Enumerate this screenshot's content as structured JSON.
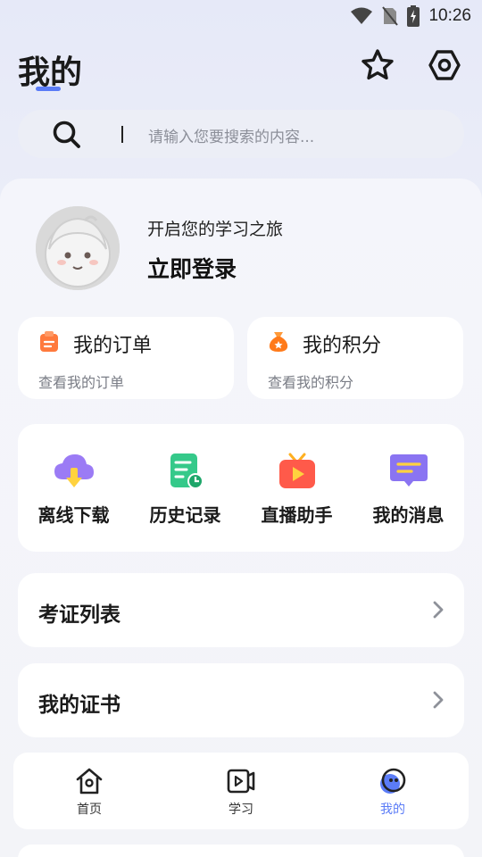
{
  "status": {
    "time": "10:26"
  },
  "header": {
    "title": "我的"
  },
  "search": {
    "placeholder": "请输入您要搜索的内容..."
  },
  "profile": {
    "subtitle": "开启您的学习之旅",
    "login_label": "立即登录"
  },
  "quick_cards": [
    {
      "title": "我的订单",
      "subtitle": "查看我的订单",
      "icon": "clipboard-icon",
      "color": "#ff7a3d"
    },
    {
      "title": "我的积分",
      "subtitle": "查看我的积分",
      "icon": "coin-bag-icon",
      "color": "#ff7a1a"
    }
  ],
  "grid": [
    {
      "label": "离线下载",
      "icon": "cloud-download-icon",
      "color": "#9b7bf5"
    },
    {
      "label": "历史记录",
      "icon": "history-doc-icon",
      "color": "#35c98a"
    },
    {
      "label": "直播助手",
      "icon": "live-tv-icon",
      "color": "#ff5a4a"
    },
    {
      "label": "我的消息",
      "icon": "message-icon",
      "color": "#8a74f2"
    }
  ],
  "rows": [
    {
      "label": "考证列表"
    },
    {
      "label": "我的证书"
    }
  ],
  "tabs": [
    {
      "label": "首页",
      "icon": "home-icon",
      "active": false
    },
    {
      "label": "学习",
      "icon": "video-icon",
      "active": false
    },
    {
      "label": "我的",
      "icon": "mine-icon",
      "active": true
    }
  ],
  "colors": {
    "accent": "#5b7cf7"
  }
}
